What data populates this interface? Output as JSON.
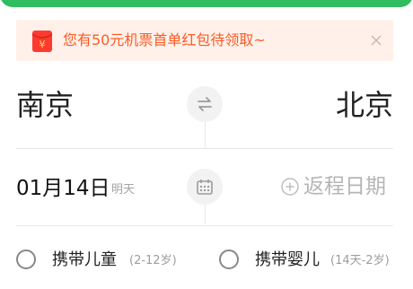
{
  "colors": {
    "accent": "#2fbd5f",
    "promo_bg": "#fff1ea",
    "promo_text": "#ff5a23",
    "envelope": "#ff3b30"
  },
  "promo": {
    "icon": "red-envelope-icon",
    "message": "您有50元机票首单红包待领取~",
    "close_icon": "close-icon"
  },
  "route": {
    "from_city": "南京",
    "to_city": "北京",
    "swap_icon": "swap-arrows-icon"
  },
  "dates": {
    "departure_date": "01月14日",
    "departure_note": "明天",
    "calendar_icon": "calendar-icon",
    "return_icon": "add-circle-icon",
    "return_label": "返程日期"
  },
  "passengers": {
    "child": {
      "label": "携带儿童",
      "range": "(2-12岁)",
      "checked": false
    },
    "infant": {
      "label": "携带婴儿",
      "range": "(14天-2岁)",
      "checked": false
    }
  }
}
